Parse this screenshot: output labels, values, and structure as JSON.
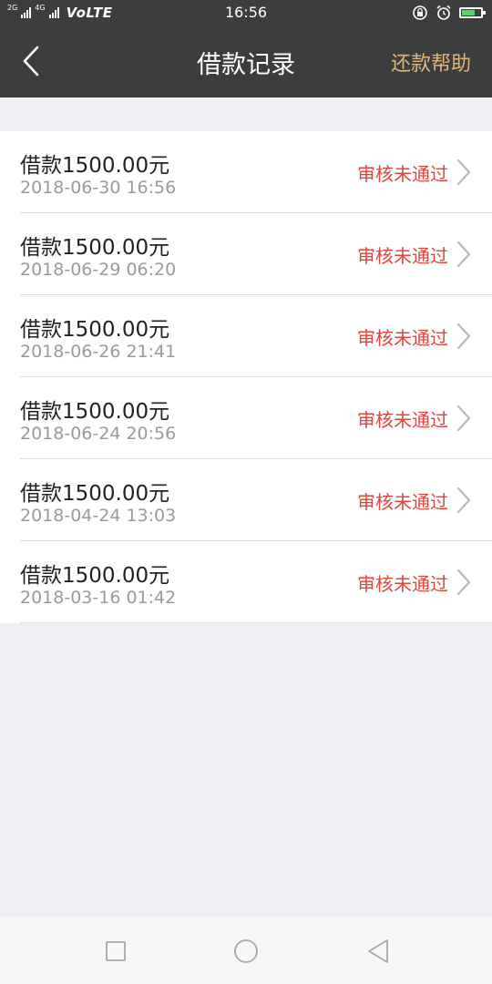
{
  "status_bar": {
    "net1": "2G",
    "net2": "4G",
    "carrier_mode": "VoLTE",
    "time": "16:56"
  },
  "header": {
    "title": "借款记录",
    "help_label": "还款帮助"
  },
  "records": [
    {
      "title": "借款1500.00元",
      "date": "2018-06-30 16:56",
      "status": "审核未通过"
    },
    {
      "title": "借款1500.00元",
      "date": "2018-06-29 06:20",
      "status": "审核未通过"
    },
    {
      "title": "借款1500.00元",
      "date": "2018-06-26 21:41",
      "status": "审核未通过"
    },
    {
      "title": "借款1500.00元",
      "date": "2018-06-24 20:56",
      "status": "审核未通过"
    },
    {
      "title": "借款1500.00元",
      "date": "2018-04-24 13:03",
      "status": "审核未通过"
    },
    {
      "title": "借款1500.00元",
      "date": "2018-03-16 01:42",
      "status": "审核未通过"
    }
  ],
  "colors": {
    "header_bg": "#3b3d3e",
    "help_accent": "#e0b572",
    "status_rejected": "#e0453c",
    "page_bg": "#efeff4"
  }
}
